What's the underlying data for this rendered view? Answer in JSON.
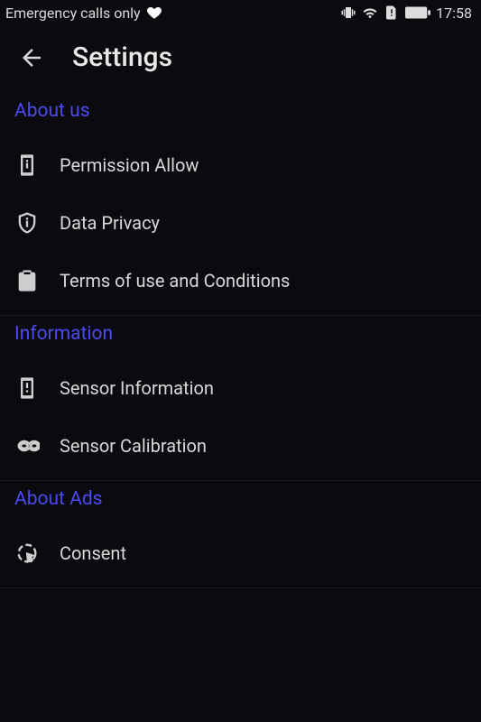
{
  "status_bar": {
    "network_text": "Emergency calls only",
    "time": "17:58"
  },
  "app_bar": {
    "title": "Settings"
  },
  "sections": {
    "about_us": {
      "header": "About us",
      "items": {
        "permission": "Permission Allow",
        "privacy": "Data Privacy",
        "terms": "Terms of use and Conditions"
      }
    },
    "information": {
      "header": "Information",
      "items": {
        "sensor_info": "Sensor Information",
        "sensor_calibration": "Sensor Calibration"
      }
    },
    "about_ads": {
      "header": "About Ads",
      "items": {
        "consent": "Consent"
      }
    }
  }
}
